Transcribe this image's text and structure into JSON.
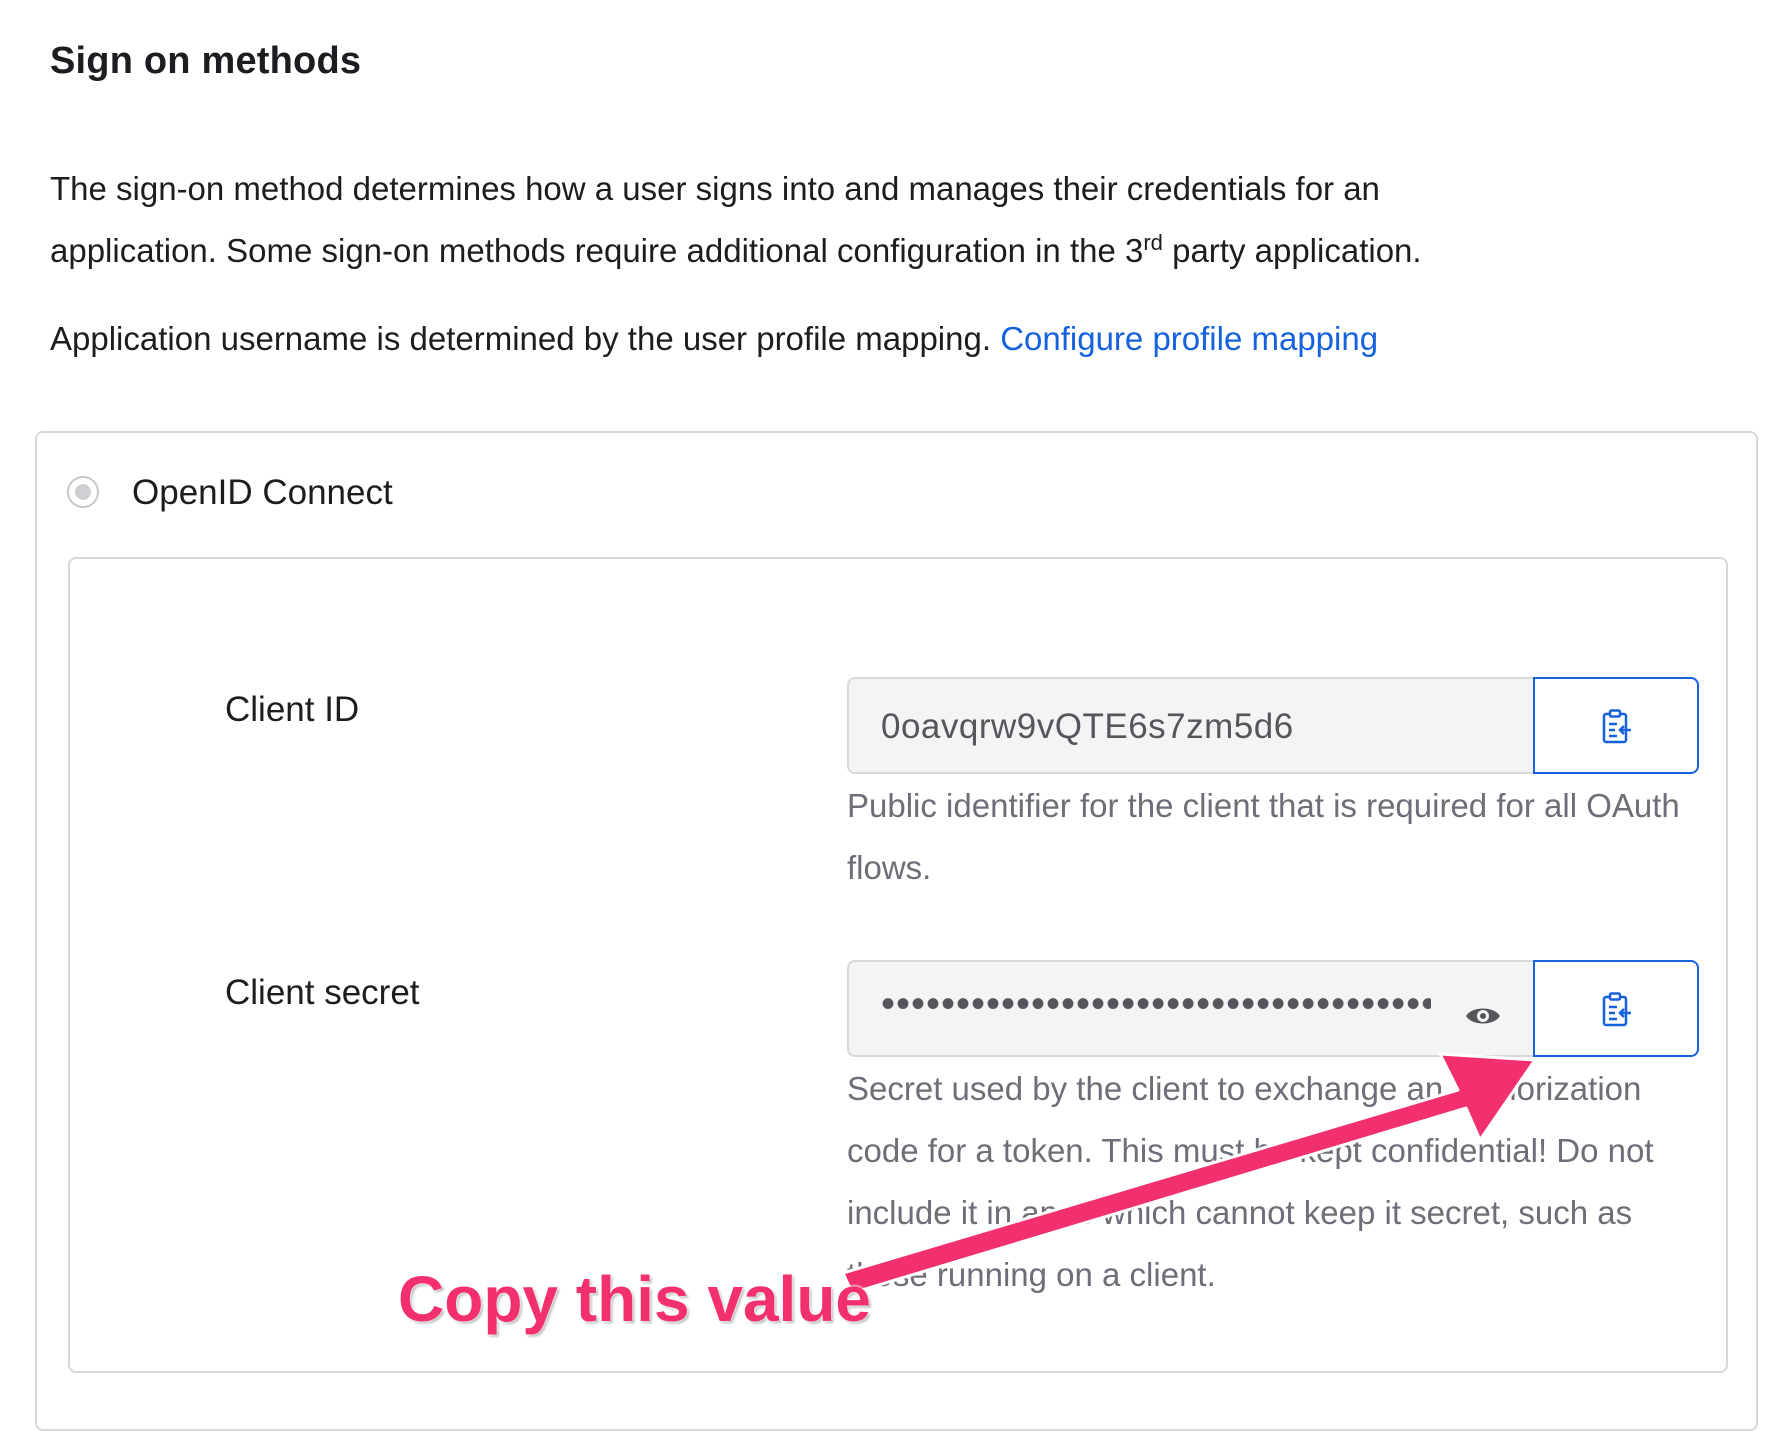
{
  "section": {
    "title": "Sign on methods",
    "intro_line1": "The sign-on method determines how a user signs into and manages their credentials for an",
    "intro_line2_pre": "application. Some sign-on methods require additional configuration in the 3",
    "intro_sup": "rd",
    "intro_line2_post": " party application.",
    "mapping_text": "Application username is determined by the user profile mapping.",
    "mapping_link": "Configure profile mapping"
  },
  "method": {
    "label": "OpenID Connect",
    "selected": true
  },
  "client_id": {
    "label": "Client ID",
    "value": "0oavqrw9vQTE6s7zm5d6",
    "help": "Public identifier for the client that is required for all OAuth flows.",
    "copy_icon": "clipboard-copy-icon"
  },
  "client_secret": {
    "label": "Client secret",
    "masked_value": "••••••••••••••••••••••••••••••••••••••",
    "help": "Secret used by the client to exchange an authorization code for a token. This must be kept confidential! Do not include it in apps which cannot keep it secret, such as those running on a client.",
    "reveal_icon": "eye-icon",
    "copy_icon": "clipboard-copy-icon"
  },
  "annotation": {
    "text": "Copy this value",
    "color": "#f2306e"
  },
  "colors": {
    "link": "#1662dd",
    "button_border": "#1662dd",
    "input_bg": "#f4f4f5"
  }
}
